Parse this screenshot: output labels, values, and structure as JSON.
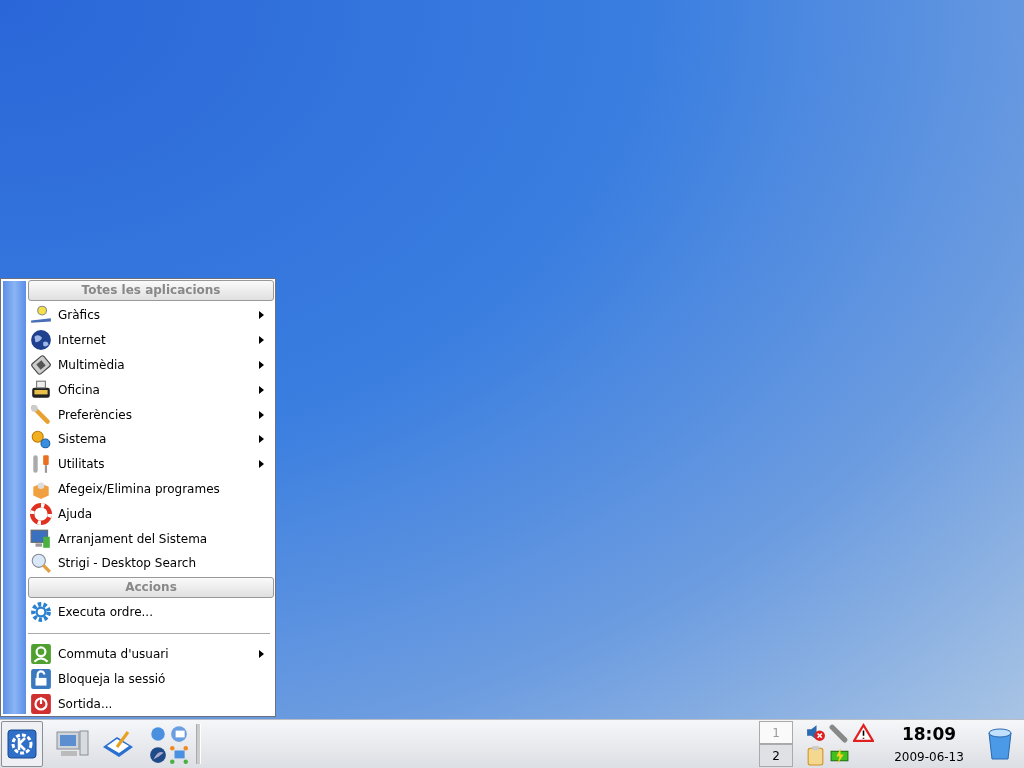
{
  "start_menu": {
    "entries": [
      {
        "kind": "header",
        "label": "Totes les aplicacions"
      },
      {
        "kind": "item",
        "label": "Gràfics",
        "submenu": true
      },
      {
        "kind": "item",
        "label": "Internet",
        "submenu": true
      },
      {
        "kind": "item",
        "label": "Multimèdia",
        "submenu": true
      },
      {
        "kind": "item",
        "label": "Oficina",
        "submenu": true
      },
      {
        "kind": "item",
        "label": "Preferències",
        "submenu": true
      },
      {
        "kind": "item",
        "label": "Sistema",
        "submenu": true
      },
      {
        "kind": "item",
        "label": "Utilitats",
        "submenu": true
      },
      {
        "kind": "item",
        "label": "Afegeix/Elimina programes",
        "submenu": false
      },
      {
        "kind": "item",
        "label": "Ajuda",
        "submenu": false
      },
      {
        "kind": "item",
        "label": "Arranjament del Sistema",
        "submenu": false
      },
      {
        "kind": "item",
        "label": "Strigi - Desktop Search",
        "submenu": false
      },
      {
        "kind": "header",
        "label": "Accions"
      },
      {
        "kind": "item",
        "label": "Executa ordre...",
        "submenu": false
      },
      {
        "kind": "separator"
      },
      {
        "kind": "item",
        "label": "Commuta d'usuari",
        "submenu": true
      },
      {
        "kind": "item",
        "label": "Bloqueja la sessió",
        "submenu": false
      },
      {
        "kind": "item",
        "label": "Sortida...",
        "submenu": false
      }
    ]
  },
  "taskbar": {
    "pager": [
      {
        "label": "1",
        "selected": true
      },
      {
        "label": "2",
        "selected": false
      }
    ],
    "clock": {
      "time": "18:09",
      "date": "2009-06-13"
    }
  }
}
